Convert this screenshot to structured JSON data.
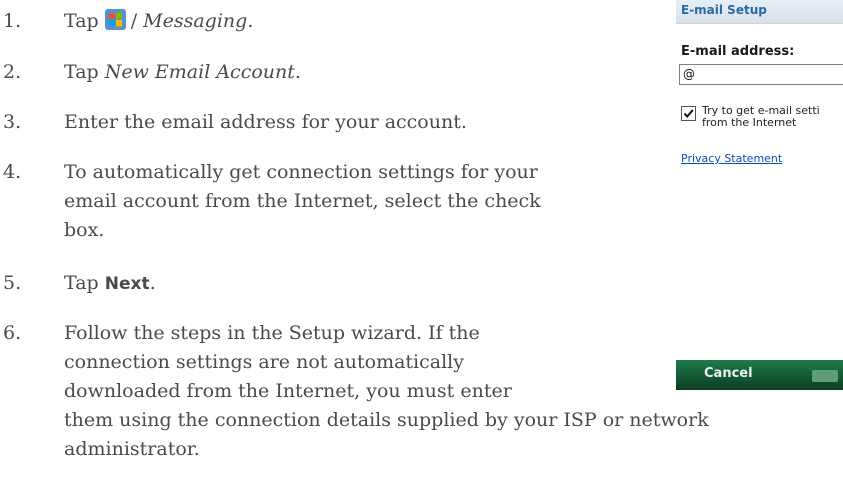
{
  "steps": [
    {
      "number": "1.",
      "prefix": "Tap",
      "icon": "windows-start-icon",
      "separator": "/",
      "menu": "Messaging",
      "end": "."
    },
    {
      "number": "2.",
      "prefix": "Tap",
      "target": "New Email Account",
      "end": "."
    },
    {
      "number": "3.",
      "text": "Enter the email address for your account."
    },
    {
      "number": "4.",
      "lines": [
        "To automatically get connection settings for your",
        "email account from the Internet, select the check",
        "box."
      ]
    },
    {
      "number": "5.",
      "prefix": "Tap",
      "button": "Next",
      "end": "."
    },
    {
      "number": "6.",
      "lines": [
        "Follow the steps in the Setup wizard. If the",
        "connection settings are not automatically",
        "downloaded from the Internet, you must enter",
        "them using the connection details supplied by your ISP or network",
        "administrator."
      ]
    }
  ],
  "phone": {
    "title": "E-mail Setup",
    "label": "E-mail address:",
    "input_value": "@",
    "checkbox_checked": true,
    "checkbox_line1": "Try to get e-mail setti",
    "checkbox_line2": "from the Internet",
    "link": "Privacy Statement",
    "softkey_left": "Cancel"
  },
  "colors": {
    "body_text": "#4a4a4a",
    "phone_title": "#2a6aa2",
    "link": "#0f4cb0",
    "softkey_bar": "#1f7b4a"
  }
}
